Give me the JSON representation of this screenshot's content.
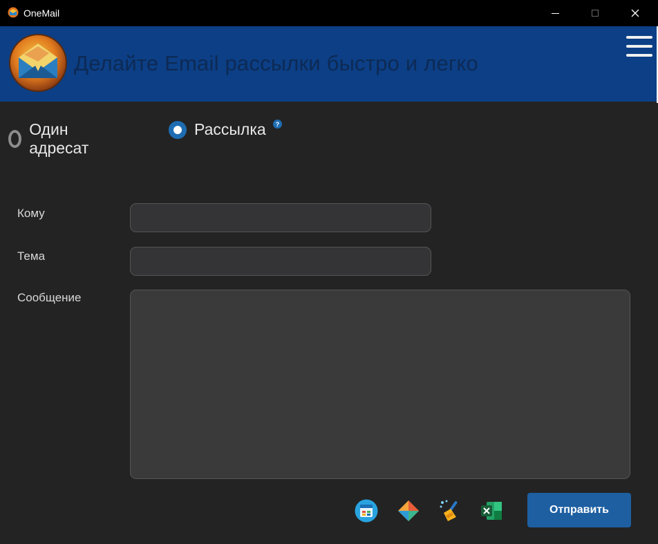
{
  "window": {
    "title": "OneMail"
  },
  "header": {
    "tagline": "Делайте Email рассылки быстро и легко",
    "background": "#0c3f85"
  },
  "mode": {
    "options": [
      {
        "label": "Один адресат",
        "selected": false
      },
      {
        "label": "Рассылка",
        "selected": true
      }
    ],
    "help_icon": "?"
  },
  "form": {
    "to_label": "Кому",
    "to_value": "",
    "subject_label": "Тема",
    "subject_value": "",
    "message_label": "Сообщение",
    "message_value": ""
  },
  "toolbar": {
    "icons": [
      "contacts-icon",
      "template-icon",
      "clear-icon",
      "excel-icon"
    ],
    "send_label": "Отправить",
    "accent": "#1e5fa2"
  }
}
